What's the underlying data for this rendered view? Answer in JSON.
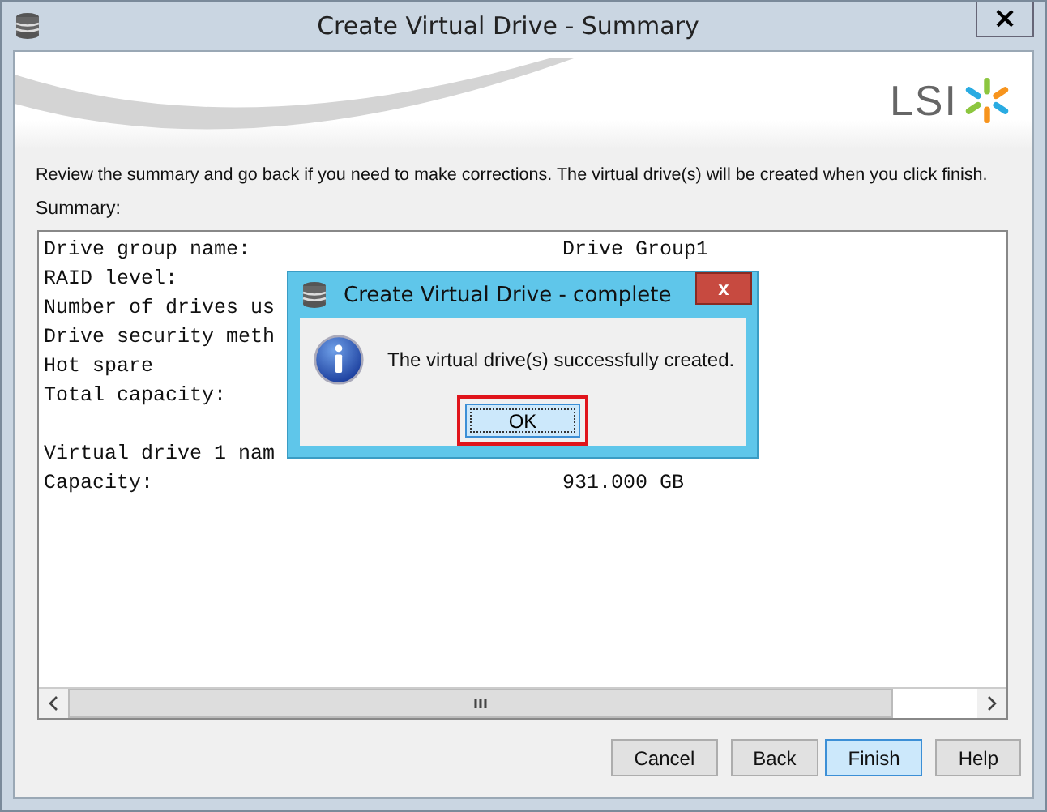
{
  "window": {
    "title": "Create Virtual Drive - Summary",
    "close": "×"
  },
  "banner": {
    "logo": "LSI"
  },
  "description": "Review the summary and go back if you need to make corrections. The virtual drive(s) will be created when you click finish.",
  "summary_label": "Summary:",
  "summary_sections": [
    {
      "lines": [
        {
          "label": "Drive group name:",
          "value": "Drive Group1"
        },
        {
          "label": "RAID level:"
        },
        {
          "label": "Number of drives us"
        },
        {
          "label": "Drive security meth"
        },
        {
          "label": "Hot spare"
        },
        {
          "label": "Total capacity:"
        }
      ]
    },
    {
      "lines": [
        {
          "label": "Virtual drive 1 nam"
        },
        {
          "label": "Capacity:",
          "value": "931.000 GB"
        }
      ]
    }
  ],
  "scrollbar": {
    "grip": "III"
  },
  "buttons": [
    {
      "label": "Cancel",
      "default": false
    },
    {
      "label": "Back",
      "default": false
    },
    {
      "label": "Finish",
      "default": true
    },
    {
      "label": "Help",
      "default": false
    }
  ],
  "dialog": {
    "title": "Create Virtual Drive - complete",
    "close": "x",
    "message": "The virtual drive(s) successfully created.",
    "button": {
      "label": "OK",
      "highlighted": true
    }
  }
}
